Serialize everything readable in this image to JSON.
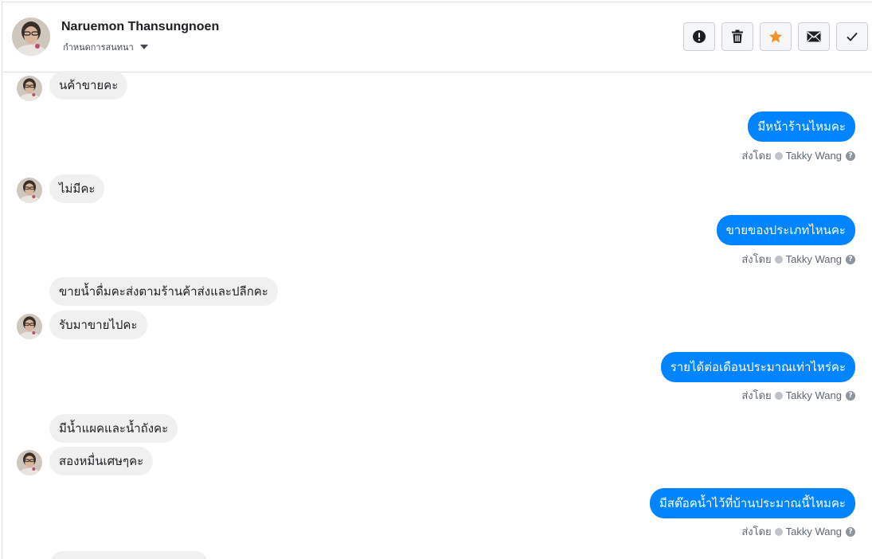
{
  "header": {
    "name": "Naruemon Thansungnoen",
    "subtitle": "กำหนดการสนทนา"
  },
  "actions": {
    "spam": "spam-icon",
    "delete": "trash-icon",
    "star": "star-icon",
    "unread": "envelope-icon",
    "done": "check-icon",
    "star_color": "#f0932b"
  },
  "messages": {
    "m1": "นค้าขายคะ",
    "m2": "มีหน้าร้านไหมคะ",
    "m3": "ไม่มีคะ",
    "m4": "ขายของประเภทไหนคะ",
    "m5": "ขายน้ำดื่มคะส่งตามร้านค้าส่งและปลีกคะ",
    "m6": "รับมาขายไปคะ",
    "m7": "รายได้ต่อเดือนประมาณเท่าไหร่คะ",
    "m8": "มีน้ำแผคและน้ำถังคะ",
    "m9": "สองหมื่นเศษๆคะ",
    "m10": "มีสต๊อคน้ำไว้ที่บ้านประมาณนี้ไหมคะ"
  },
  "sent_by": {
    "label": "ส่งโดย",
    "agent": "Takky Wang",
    "help": "?"
  },
  "colors": {
    "outgoing": "#0084ff",
    "incoming": "#f1f0f0"
  }
}
